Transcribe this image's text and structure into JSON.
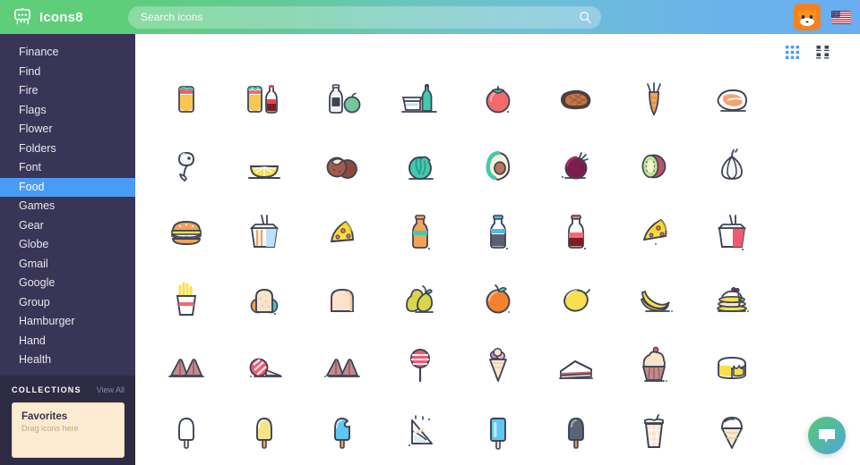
{
  "header": {
    "brand_name": "Icons8",
    "logo_icon": "robot-logo-icon",
    "search_placeholder": "Search icons",
    "search_value": "",
    "search_icon": "search-icon",
    "avatar_icon": "fox-avatar-icon",
    "flag_icon": "us-flag-icon",
    "gradient_start": "#5ECE7B",
    "gradient_end": "#69AEF2"
  },
  "sidebar": {
    "background": "#393556",
    "active_color": "#4A9BF7",
    "items": [
      {
        "label": "Finance",
        "active": false
      },
      {
        "label": "Find",
        "active": false
      },
      {
        "label": "Fire",
        "active": false
      },
      {
        "label": "Flags",
        "active": false
      },
      {
        "label": "Flower",
        "active": false
      },
      {
        "label": "Folders",
        "active": false
      },
      {
        "label": "Font",
        "active": false
      },
      {
        "label": "Food",
        "active": true
      },
      {
        "label": "Games",
        "active": false
      },
      {
        "label": "Gear",
        "active": false
      },
      {
        "label": "Globe",
        "active": false
      },
      {
        "label": "Gmail",
        "active": false
      },
      {
        "label": "Google",
        "active": false
      },
      {
        "label": "Group",
        "active": false
      },
      {
        "label": "Hamburger",
        "active": false
      },
      {
        "label": "Hand",
        "active": false
      },
      {
        "label": "Health",
        "active": false
      }
    ],
    "collections": {
      "title": "COLLECTIONS",
      "view_all": "View All",
      "favorites_title": "Favorites",
      "favorites_hint": "Drag icons here",
      "card_color": "#FCEBD0"
    }
  },
  "main": {
    "toolbar": {
      "grid_view_icon": "grid-view-icon",
      "grid_view_active": true,
      "grid_view_color": "#4A9BF7",
      "detail_view_icon": "detail-view-icon",
      "detail_view_color": "#3d4455"
    },
    "columns": 8,
    "icons": [
      {
        "name": "taco-icon",
        "label": "Taco"
      },
      {
        "name": "taco-and-cola-icon",
        "label": "Taco and Cola"
      },
      {
        "name": "milk-and-apple-icon",
        "label": "Milk and Apple"
      },
      {
        "name": "lunch-box-and-bottle-icon",
        "label": "Lunch Box"
      },
      {
        "name": "tomato-icon",
        "label": "Tomato"
      },
      {
        "name": "steak-icon",
        "label": "Steak"
      },
      {
        "name": "carrot-icon",
        "label": "Carrot"
      },
      {
        "name": "salmon-fillet-icon",
        "label": "Salmon"
      },
      {
        "name": "fish-icon",
        "label": "Fish"
      },
      {
        "name": "lemon-slice-icon",
        "label": "Lemon Slice"
      },
      {
        "name": "chestnut-icon",
        "label": "Chestnut"
      },
      {
        "name": "cabbage-icon",
        "label": "Cabbage"
      },
      {
        "name": "avocado-icon",
        "label": "Avocado"
      },
      {
        "name": "beet-icon",
        "label": "Beet"
      },
      {
        "name": "kiwi-icon",
        "label": "Kiwi"
      },
      {
        "name": "garlic-icon",
        "label": "Garlic"
      },
      {
        "name": "hamburger-icon",
        "label": "Hamburger"
      },
      {
        "name": "noodle-box-icon",
        "label": "Noodle Box"
      },
      {
        "name": "pizza-slice-icon",
        "label": "Pizza"
      },
      {
        "name": "orange-soda-bottle-icon",
        "label": "Orange Soda"
      },
      {
        "name": "water-bottle-icon",
        "label": "Water Bottle"
      },
      {
        "name": "cola-bottle-icon",
        "label": "Cola Bottle"
      },
      {
        "name": "pizza-slice-alt-icon",
        "label": "Pizza Slice"
      },
      {
        "name": "red-noodle-box-icon",
        "label": "Noodle Box Red"
      },
      {
        "name": "french-fries-icon",
        "label": "French Fries"
      },
      {
        "name": "sandwich-icon",
        "label": "Sandwich"
      },
      {
        "name": "bread-slice-icon",
        "label": "Bread Slice"
      },
      {
        "name": "pear-icon",
        "label": "Pear"
      },
      {
        "name": "orange-icon",
        "label": "Orange"
      },
      {
        "name": "lemon-icon",
        "label": "Lemon"
      },
      {
        "name": "banana-icon",
        "label": "Banana"
      },
      {
        "name": "pancakes-icon",
        "label": "Pancakes"
      },
      {
        "name": "fortune-cookies-icon",
        "label": "Fortune Cookies"
      },
      {
        "name": "candy-icon",
        "label": "Candy"
      },
      {
        "name": "fortune-cookies-alt-icon",
        "label": "Fortune Cookies"
      },
      {
        "name": "lollipop-icon",
        "label": "Lollipop"
      },
      {
        "name": "ice-cream-cone-icon",
        "label": "Ice Cream Cone"
      },
      {
        "name": "cake-slice-icon",
        "label": "Cake Slice"
      },
      {
        "name": "cupcake-icon",
        "label": "Cupcake"
      },
      {
        "name": "cheesecake-icon",
        "label": "Cheesecake"
      },
      {
        "name": "popsicle-white-icon",
        "label": "Popsicle"
      },
      {
        "name": "popsicle-yellow-icon",
        "label": "Popsicle Yellow"
      },
      {
        "name": "popsicle-blue-icon",
        "label": "Popsicle Blue"
      },
      {
        "name": "ice-cream-cone-outline-icon",
        "label": "Ice Cream Cone"
      },
      {
        "name": "ice-bar-blue-icon",
        "label": "Ice Bar"
      },
      {
        "name": "popsicle-gray-icon",
        "label": "Popsicle Gray"
      },
      {
        "name": "milkshake-icon",
        "label": "Milkshake"
      },
      {
        "name": "soft-serve-icon",
        "label": "Soft Serve"
      }
    ]
  },
  "chat": {
    "icon": "chat-bubble-icon",
    "gradient_start": "#57C97E",
    "gradient_end": "#4FA3DE"
  }
}
